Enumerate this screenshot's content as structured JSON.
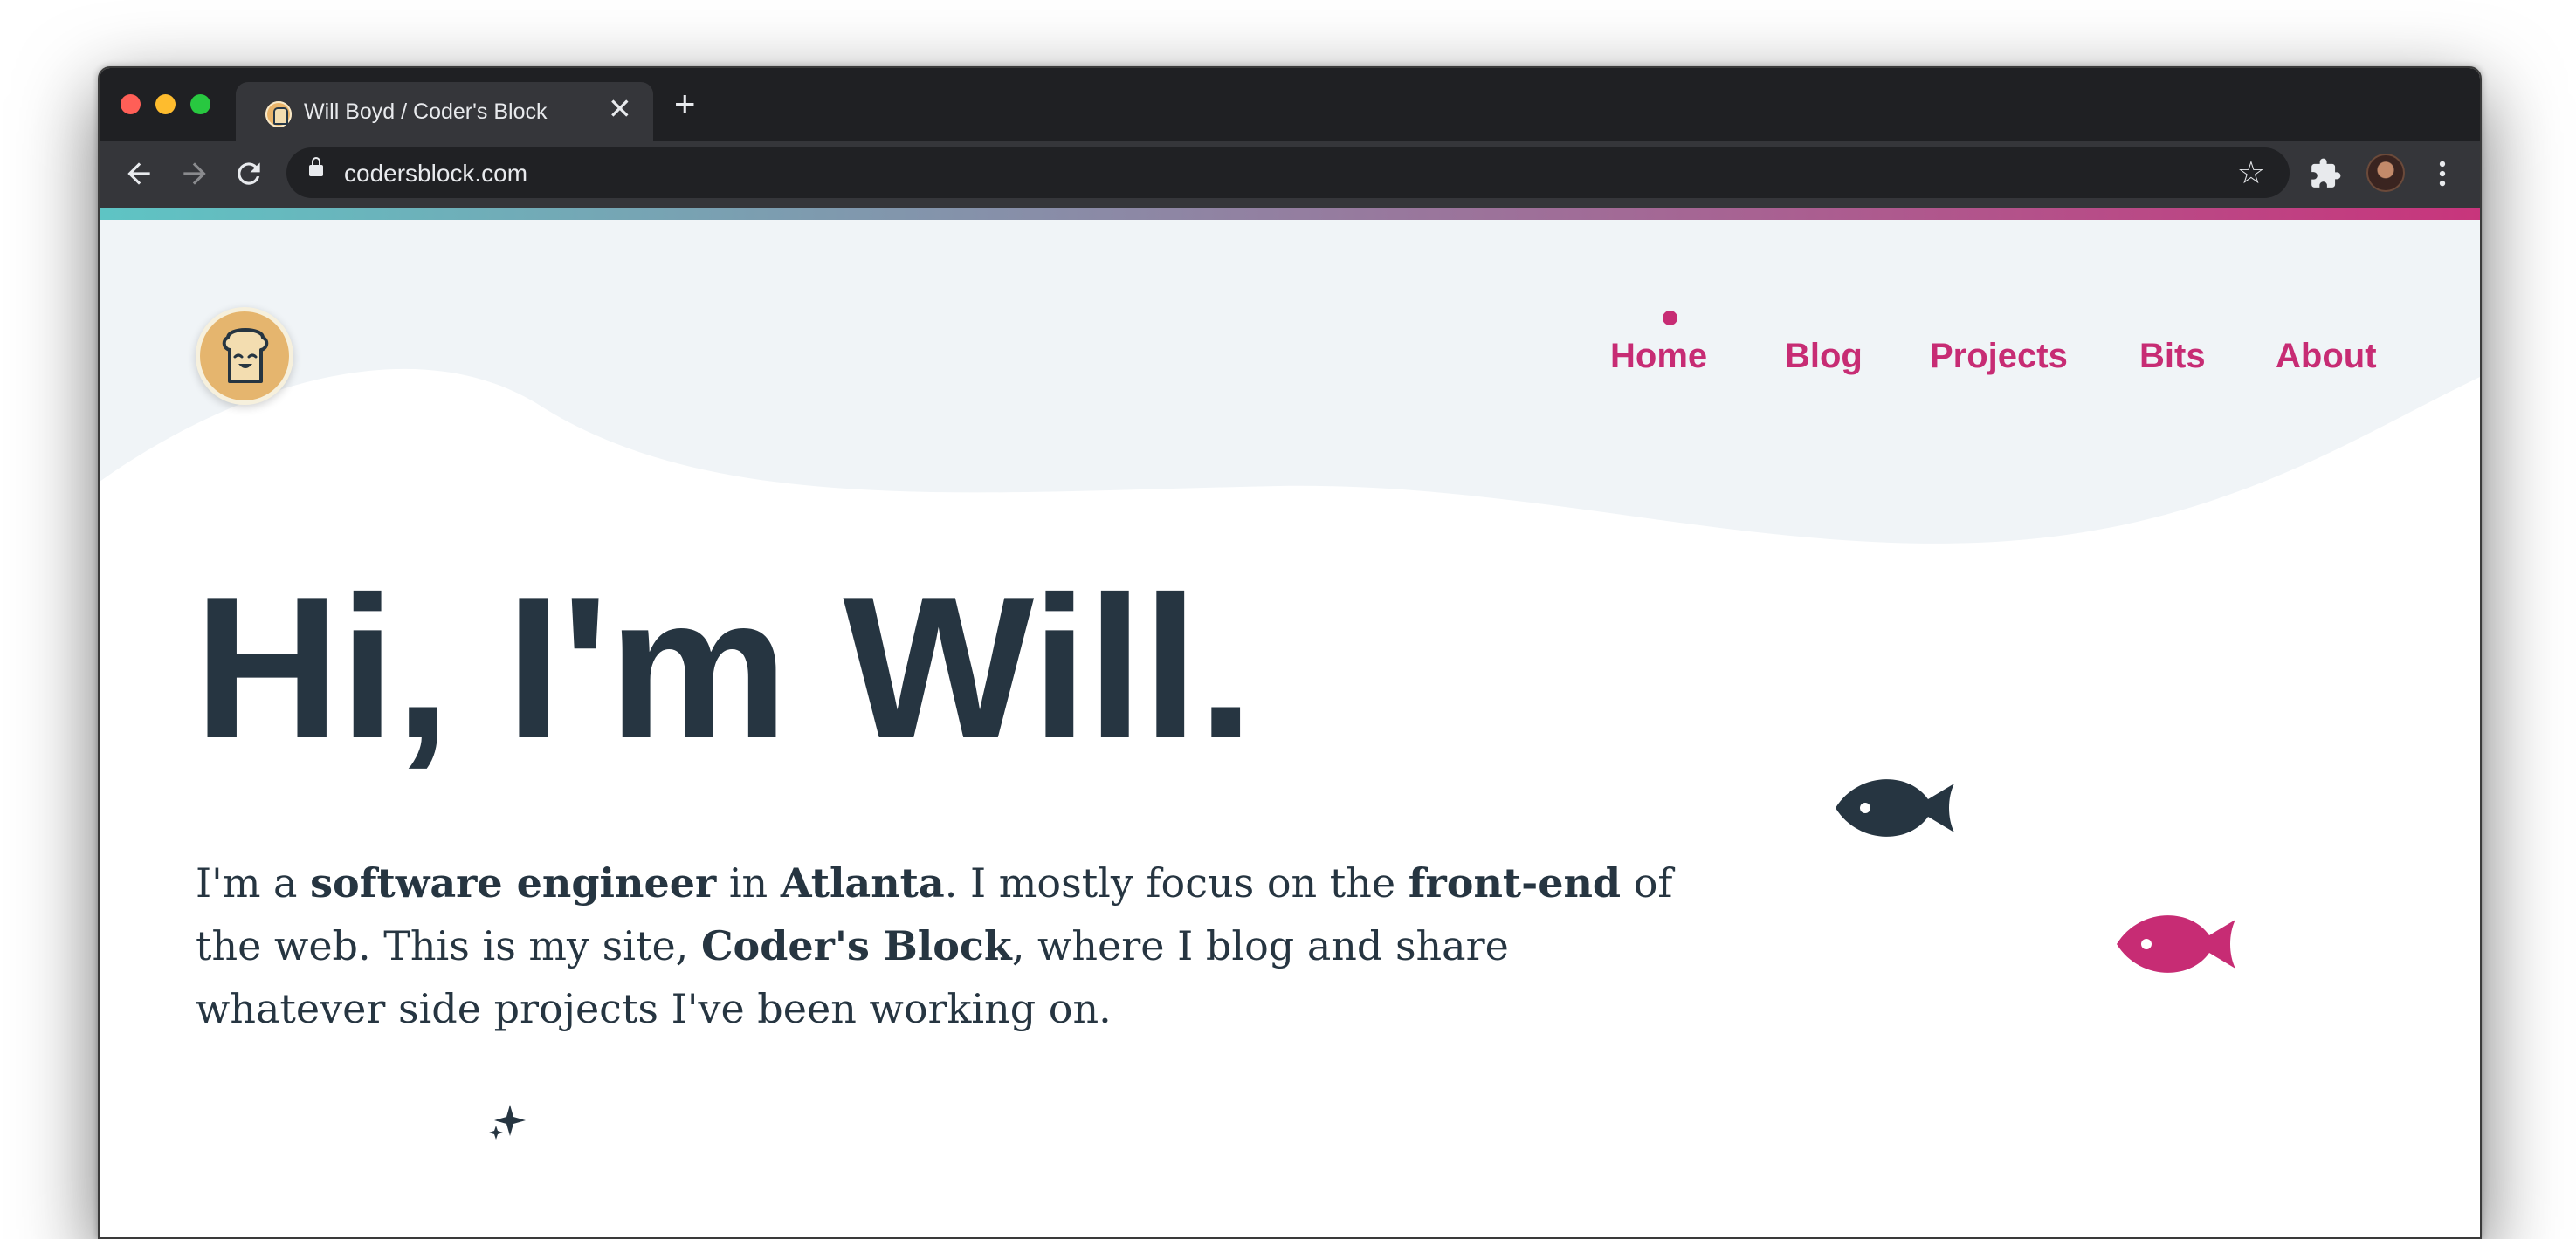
{
  "browser": {
    "tab_title": "Will Boyd / Coder's Block",
    "url": "codersblock.com",
    "colors": {
      "frame": "#1f2023",
      "toolbar": "#35363a",
      "close": "#ff5f57",
      "minimize": "#febc2e",
      "maximize": "#28c840"
    }
  },
  "site": {
    "accent_color": "#c72c74",
    "text_color": "#263541",
    "nav": {
      "active": "Home",
      "items": [
        "Home",
        "Blog",
        "Projects",
        "Bits",
        "About"
      ]
    },
    "headline": "Hi, I'm Will.",
    "intro": {
      "p1": "I'm a ",
      "b1": "software engineer",
      "p2": " in ",
      "b2": "Atlanta",
      "p3": ". I mostly focus on the ",
      "b3": "front-end",
      "p4": " of the web. This is my site, ",
      "b4": "Coder's Block",
      "p5": ", where I blog and share whatever side projects I've been working on."
    },
    "icons": {
      "logo": "toast-logo-icon",
      "fish_dark": "fish-icon",
      "fish_pink": "fish-icon",
      "sparkle": "sparkle-icon"
    }
  }
}
